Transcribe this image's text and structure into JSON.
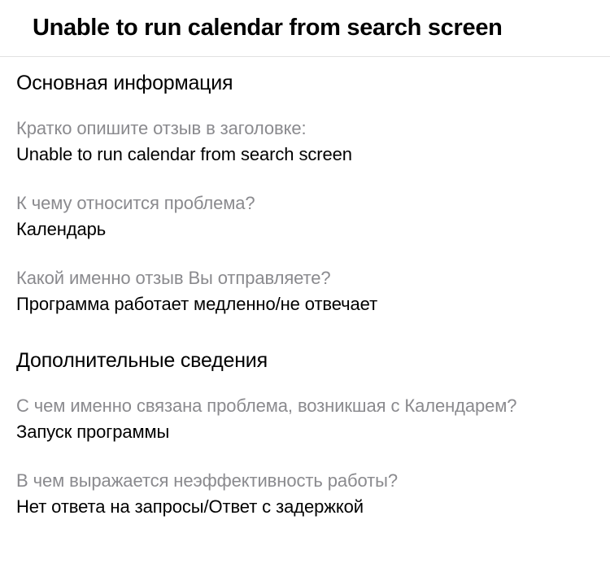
{
  "header": {
    "title": "Unable to run calendar from search screen"
  },
  "sections": {
    "basic": {
      "heading": "Основная информация",
      "fields": {
        "summary": {
          "label": "Кратко опишите отзыв в заголовке:",
          "value": "Unable to run calendar from search screen"
        },
        "area": {
          "label": "К чему относится проблема?",
          "value": "Календарь"
        },
        "feedbackType": {
          "label": "Какой именно отзыв Вы отправляете?",
          "value": "Программа работает медленно/не отвечает"
        }
      }
    },
    "additional": {
      "heading": "Дополнительные сведения",
      "fields": {
        "problemDetail": {
          "label": "С чем именно связана проблема, возникшая с Календарем?",
          "value": "Запуск программы"
        },
        "inefficiency": {
          "label": "В чем выражается неэффективность работы?",
          "value": "Нет ответа на запросы/Ответ с задержкой"
        }
      }
    }
  }
}
